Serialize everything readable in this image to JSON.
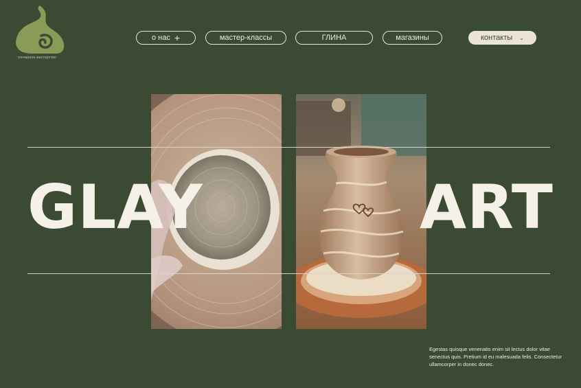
{
  "brand": {
    "caption": "гончарное мастерство"
  },
  "nav": {
    "items": [
      {
        "label": "о нас",
        "has_plus": true
      },
      {
        "label": "мастер-классы"
      },
      {
        "label": "ГЛИНА"
      },
      {
        "label": "магазины"
      }
    ],
    "contact_label": "контакты"
  },
  "hero": {
    "word_left": "GLAY",
    "word_right": "ART"
  },
  "description": "Egestas quisque venenatis enim sit lectus dolor vitae senectus quis. Pretium id eu malesuada felis. Consectetur ullamcorper in donec donec.",
  "colors": {
    "background": "#3a4a33",
    "accent": "#8a9a57",
    "text": "#f5f1e8",
    "contact_button": "#ebe4d6"
  }
}
